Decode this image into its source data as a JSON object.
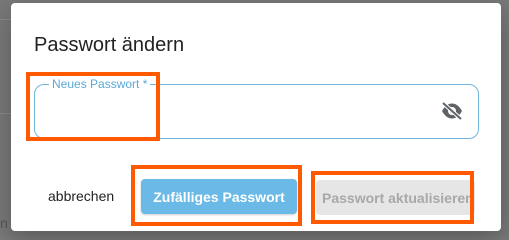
{
  "background": {
    "partial_text": "n"
  },
  "dialog": {
    "title": "Passwort ändern",
    "password_field": {
      "label": "Neues Passwort *",
      "value": "",
      "visibility_icon": "eye-off-icon"
    },
    "actions": {
      "cancel_label": "abbrechen",
      "random_password_label": "Zufälliges Passwort",
      "update_password_label": "Passwort aktualisieren",
      "update_password_disabled": true
    }
  },
  "colors": {
    "primary": "#6ab9e6",
    "field_border": "#6fb6dc",
    "field_label": "#5aa9d8",
    "disabled_bg": "#e6e6e6",
    "disabled_text": "#a8a8a8",
    "annotation": "#ff5a00"
  }
}
